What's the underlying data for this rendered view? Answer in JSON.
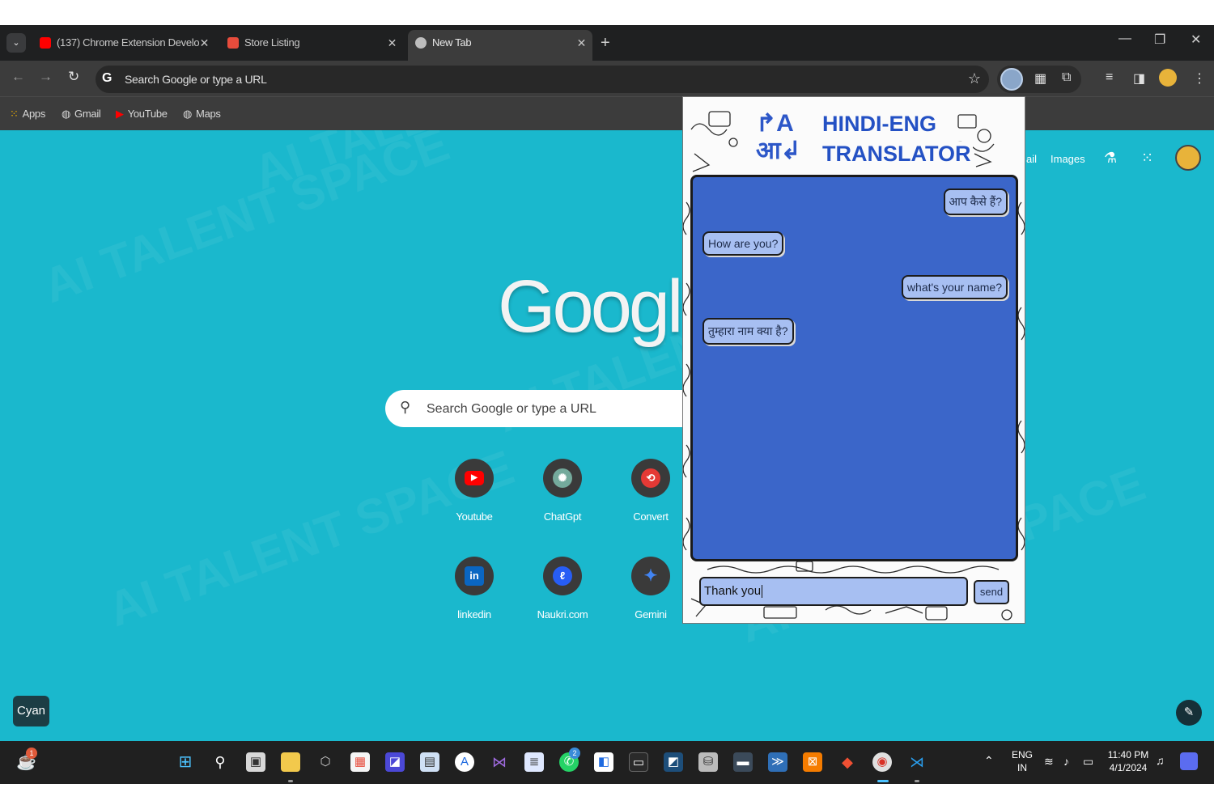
{
  "browser": {
    "tabs": [
      {
        "title": "(137) Chrome Extension Develo",
        "favicon_color": "#ff0000"
      },
      {
        "title": "Store Listing",
        "favicon_color": "#e74c3c"
      },
      {
        "title": "New Tab",
        "favicon_color": "#bdbdbd"
      }
    ],
    "omnibox_text": "Search Google or type a URL",
    "bookmarks": [
      {
        "label": "Apps"
      },
      {
        "label": "Gmail"
      },
      {
        "label": "YouTube"
      },
      {
        "label": "Maps"
      }
    ]
  },
  "ntp": {
    "logo_text": "Googl",
    "search_placeholder": "Search Google or type a URL",
    "links": {
      "gmail": "ail",
      "images": "Images"
    },
    "shortcuts": [
      {
        "label": "Youtube",
        "color": "#ff0000"
      },
      {
        "label": "ChatGpt",
        "color": "#74aa9c"
      },
      {
        "label": "Convert",
        "color": "#e53935"
      },
      {
        "label": "linkedin",
        "color": "#0a66c2"
      },
      {
        "label": "Naukri.com",
        "color": "#275df5"
      },
      {
        "label": "Gemini",
        "color": "#4285f4"
      }
    ],
    "theme_button_label": "Cyan",
    "background_color": "#1ab8cd"
  },
  "popup": {
    "title_line1": "HINDI-ENG",
    "title_line2": "TRANSLATOR",
    "logo_top": "A",
    "logo_bottom": "आ",
    "messages": [
      {
        "text": "आप कैसे हैं?",
        "side": "right"
      },
      {
        "text": "How are you?",
        "side": "left"
      },
      {
        "text": "what's your name?",
        "side": "right"
      },
      {
        "text": "तुम्हारा नाम क्या है?",
        "side": "left"
      }
    ],
    "input_value": "Thank you",
    "send_label": "send",
    "accent": "#3b66c9"
  },
  "taskbar": {
    "notification_count": "1",
    "whatsapp_count": "2",
    "language_line1": "ENG",
    "language_line2": "IN",
    "time": "11:40 PM",
    "date": "4/1/2024"
  },
  "watermark_text": "AI TALENT SPACE"
}
